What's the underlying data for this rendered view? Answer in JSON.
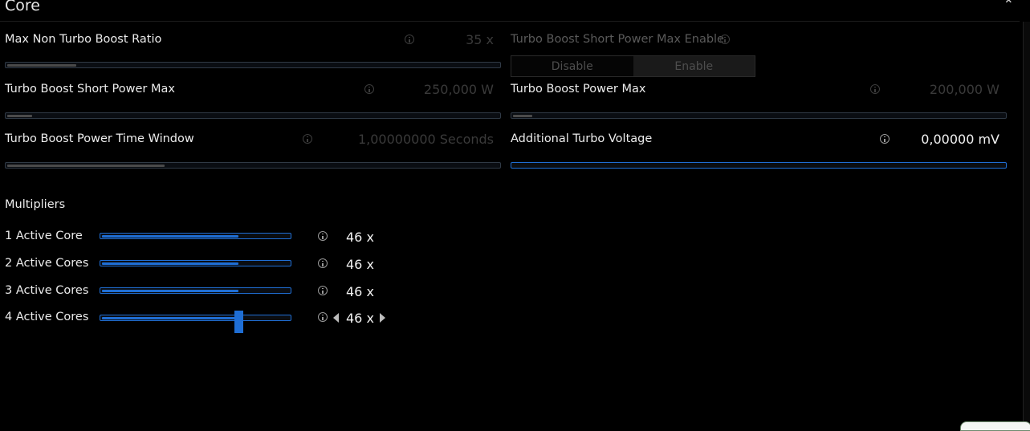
{
  "section": {
    "title": "Core",
    "collapse_glyph": "⌃"
  },
  "colors": {
    "accent": "#1f6ed4",
    "disabled": "#4a4a4a",
    "background": "#000000"
  },
  "settings": {
    "max_non_turbo_ratio": {
      "label": "Max Non Turbo Boost Ratio",
      "value": "35 x",
      "level": 0.14,
      "enabled": false
    },
    "short_power_max_enable": {
      "label": "Turbo Boost Short Power Max Enable",
      "options": [
        "Disable",
        "Enable"
      ],
      "selected": "Enable",
      "enabled": false
    },
    "short_power_max": {
      "label": "Turbo Boost Short Power Max",
      "value": "250,000 W",
      "level": 0.05,
      "enabled": false
    },
    "power_max": {
      "label": "Turbo Boost Power Max",
      "value": "200,000 W",
      "level": 0.04,
      "enabled": false
    },
    "time_window": {
      "label": "Turbo Boost Power Time Window",
      "value": "1,00000000 Seconds",
      "level": 0.32,
      "enabled": false
    },
    "additional_voltage": {
      "label": "Additional Turbo Voltage",
      "value": "0,00000 mV",
      "level": 0.0,
      "enabled": true
    }
  },
  "multipliers": {
    "title": "Multipliers",
    "items": [
      {
        "label": "1 Active Core",
        "value": "46 x",
        "level": 0.73
      },
      {
        "label": "2 Active Cores",
        "value": "46 x",
        "level": 0.73
      },
      {
        "label": "3 Active Cores",
        "value": "46 x",
        "level": 0.73
      },
      {
        "label": "4 Active Cores",
        "value": "46 x",
        "level": 0.73,
        "focused": true
      }
    ]
  }
}
